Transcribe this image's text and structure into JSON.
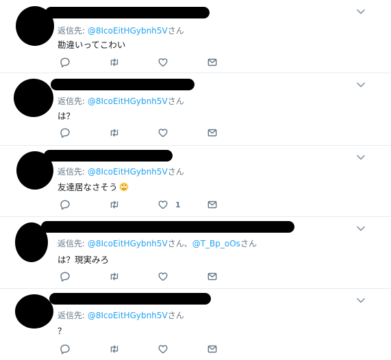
{
  "colors": {
    "link": "#1da1f2",
    "muted": "#657786",
    "text": "#14171a",
    "divider": "#e6ecf0"
  },
  "icons": [
    "reply-icon",
    "retweet-icon",
    "like-icon",
    "direct-message-icon",
    "chevron-down-icon"
  ],
  "tweets": [
    {
      "reply_prefix": "返信先: ",
      "reply_handles": "@8IcoEitHGybnh5V",
      "reply_suffix": "さん",
      "text": "勘違いってこわい",
      "like_count": ""
    },
    {
      "reply_prefix": "返信先: ",
      "reply_handles": "@8IcoEitHGybnh5V",
      "reply_suffix": "さん",
      "text": "は？",
      "like_count": ""
    },
    {
      "reply_prefix": "返信先: ",
      "reply_handles": "@8IcoEitHGybnh5V",
      "reply_suffix": "さん",
      "text": "友達居なさそう",
      "text_emoji": "face-with-rolling-eyes",
      "like_count": "1"
    },
    {
      "reply_prefix": "返信先: ",
      "reply_handles": "@8IcoEitHGybnh5V",
      "reply_suffix": "さん、",
      "reply_handles_2": "@T_Bp_oOs",
      "reply_suffix_2": "さん",
      "text": "は？現実みろ",
      "like_count": ""
    },
    {
      "reply_prefix": "返信先: ",
      "reply_handles": "@8IcoEitHGybnh5V",
      "reply_suffix": "さん",
      "text": "？",
      "like_count": ""
    }
  ]
}
